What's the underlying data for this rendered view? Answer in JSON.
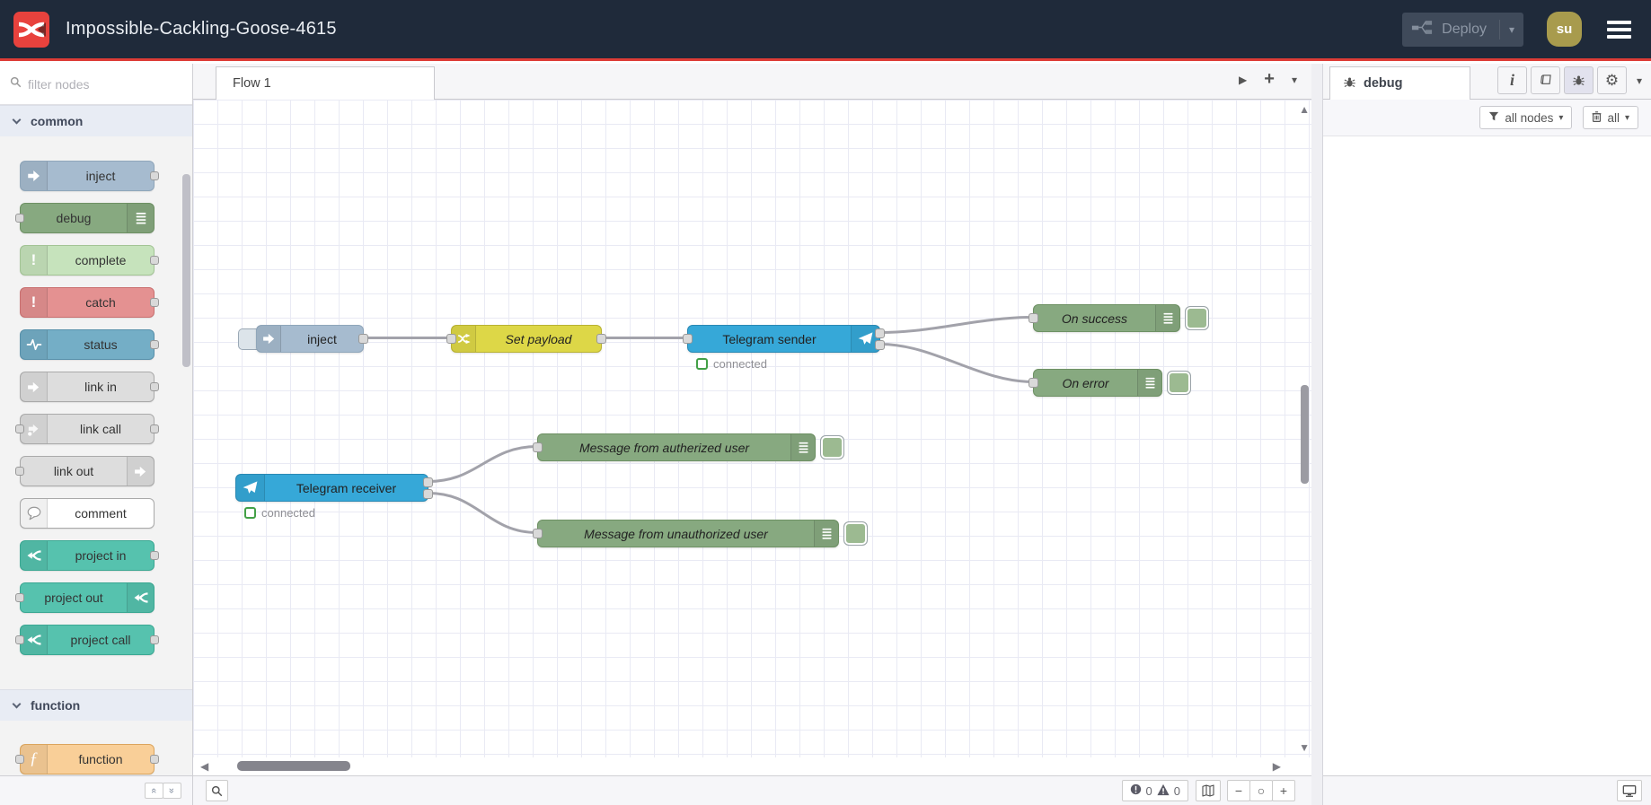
{
  "header": {
    "title": "Impossible-Cackling-Goose-4615",
    "deploy_label": "Deploy",
    "user_initials": "su"
  },
  "icons": {
    "chevron_down": "▾",
    "play": "▶",
    "plus": "+",
    "gear": "⚙",
    "info": "i",
    "scroll_up": "▲",
    "scroll_down": "▼",
    "scroll_left": "◀",
    "scroll_right": "▶",
    "zoom_out": "−",
    "zoom_reset": "○",
    "zoom_in": "+",
    "collapse_chevrons": "«",
    "function_glyph": "ƒ",
    "exclamation": "!"
  },
  "palette": {
    "filter_placeholder": "filter nodes",
    "categories": [
      {
        "label": "common",
        "nodes": [
          {
            "label": "inject",
            "color": "#a6bbcf",
            "border": "#8fa6ba"
          },
          {
            "label": "debug",
            "color": "#87a980",
            "border": "#6e9164"
          },
          {
            "label": "complete",
            "color": "#c6e3bc",
            "border": "#a3c495"
          },
          {
            "label": "catch",
            "color": "#e49191",
            "border": "#c97070"
          },
          {
            "label": "status",
            "color": "#74aec6",
            "border": "#5991ab"
          },
          {
            "label": "link in",
            "color": "#dddddd",
            "border": "#aaaaaa"
          },
          {
            "label": "link call",
            "color": "#dddddd",
            "border": "#aaaaaa"
          },
          {
            "label": "link out",
            "color": "#dddddd",
            "border": "#aaaaaa"
          },
          {
            "label": "comment",
            "color": "#ffffff",
            "border": "#a9a9a9"
          },
          {
            "label": "project in",
            "color": "#56c2ae",
            "border": "#3ba893"
          },
          {
            "label": "project out",
            "color": "#56c2ae",
            "border": "#3ba893"
          },
          {
            "label": "project call",
            "color": "#56c2ae",
            "border": "#3ba893"
          }
        ]
      },
      {
        "label": "function",
        "nodes": [
          {
            "label": "function",
            "color": "#f9cf98",
            "border": "#dba55e"
          }
        ]
      }
    ]
  },
  "workspace": {
    "tabs": [
      {
        "label": "Flow 1"
      }
    ]
  },
  "flow": {
    "nodes": [
      {
        "label": "inject",
        "color": "#a6bbcf",
        "border": "#8fa6ba"
      },
      {
        "label": "Set payload",
        "color": "#ddd747",
        "border": "#b9b232"
      },
      {
        "label": "Telegram sender",
        "color": "#36a8d8",
        "border": "#2a89b4",
        "status": "connected"
      },
      {
        "label": "On success",
        "color": "#87a980",
        "border": "#6e9164"
      },
      {
        "label": "On error",
        "color": "#87a980",
        "border": "#6e9164"
      },
      {
        "label": "Telegram receiver",
        "color": "#36a8d8",
        "border": "#2a89b4",
        "status": "connected"
      },
      {
        "label": "Message from autherized user",
        "color": "#87a980",
        "border": "#6e9164"
      },
      {
        "label": "Message from unauthorized user",
        "color": "#87a980",
        "border": "#6e9164"
      }
    ]
  },
  "debug_panel": {
    "tab_label": "debug",
    "filter_label": "all nodes",
    "clear_label": "all"
  },
  "statusbar": {
    "error_count": "0",
    "warning_count": "0"
  }
}
